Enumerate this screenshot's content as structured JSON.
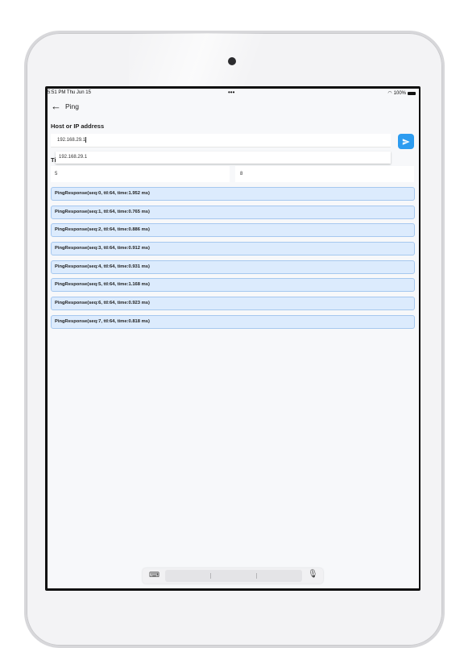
{
  "status_bar": {
    "time": "5:51 PM   Thu Jun 15",
    "dots": "•••",
    "battery": "100%"
  },
  "app_bar": {
    "back_icon": "arrow-left-icon",
    "title": "Ping"
  },
  "form": {
    "host_label": "Host or IP address",
    "host_value": "192.168.29.1",
    "autocomplete_suggestion": "192.168.29.1",
    "covered_label": "Ti",
    "field_left_value": "5",
    "field_right_value": "8",
    "send_icon": "send-icon",
    "accent_color": "#2d9cf0"
  },
  "results": [
    "PingResponse(seq:0, ttl:64, time:1.952 ms)",
    "PingResponse(seq:1, ttl:64, time:0.765 ms)",
    "PingResponse(seq:2, ttl:64, time:0.886 ms)",
    "PingResponse(seq:3, ttl:64, time:0.912 ms)",
    "PingResponse(seq:4, ttl:64, time:0.931 ms)",
    "PingResponse(seq:5, ttl:64, time:1.168 ms)",
    "PingResponse(seq:6, ttl:64, time:0.923 ms)",
    "PingResponse(seq:7, ttl:64, time:0.818 ms)"
  ],
  "keyboard_bar": {
    "keyboard_icon": "keyboard-icon",
    "mic_icon": "microphone-icon"
  }
}
